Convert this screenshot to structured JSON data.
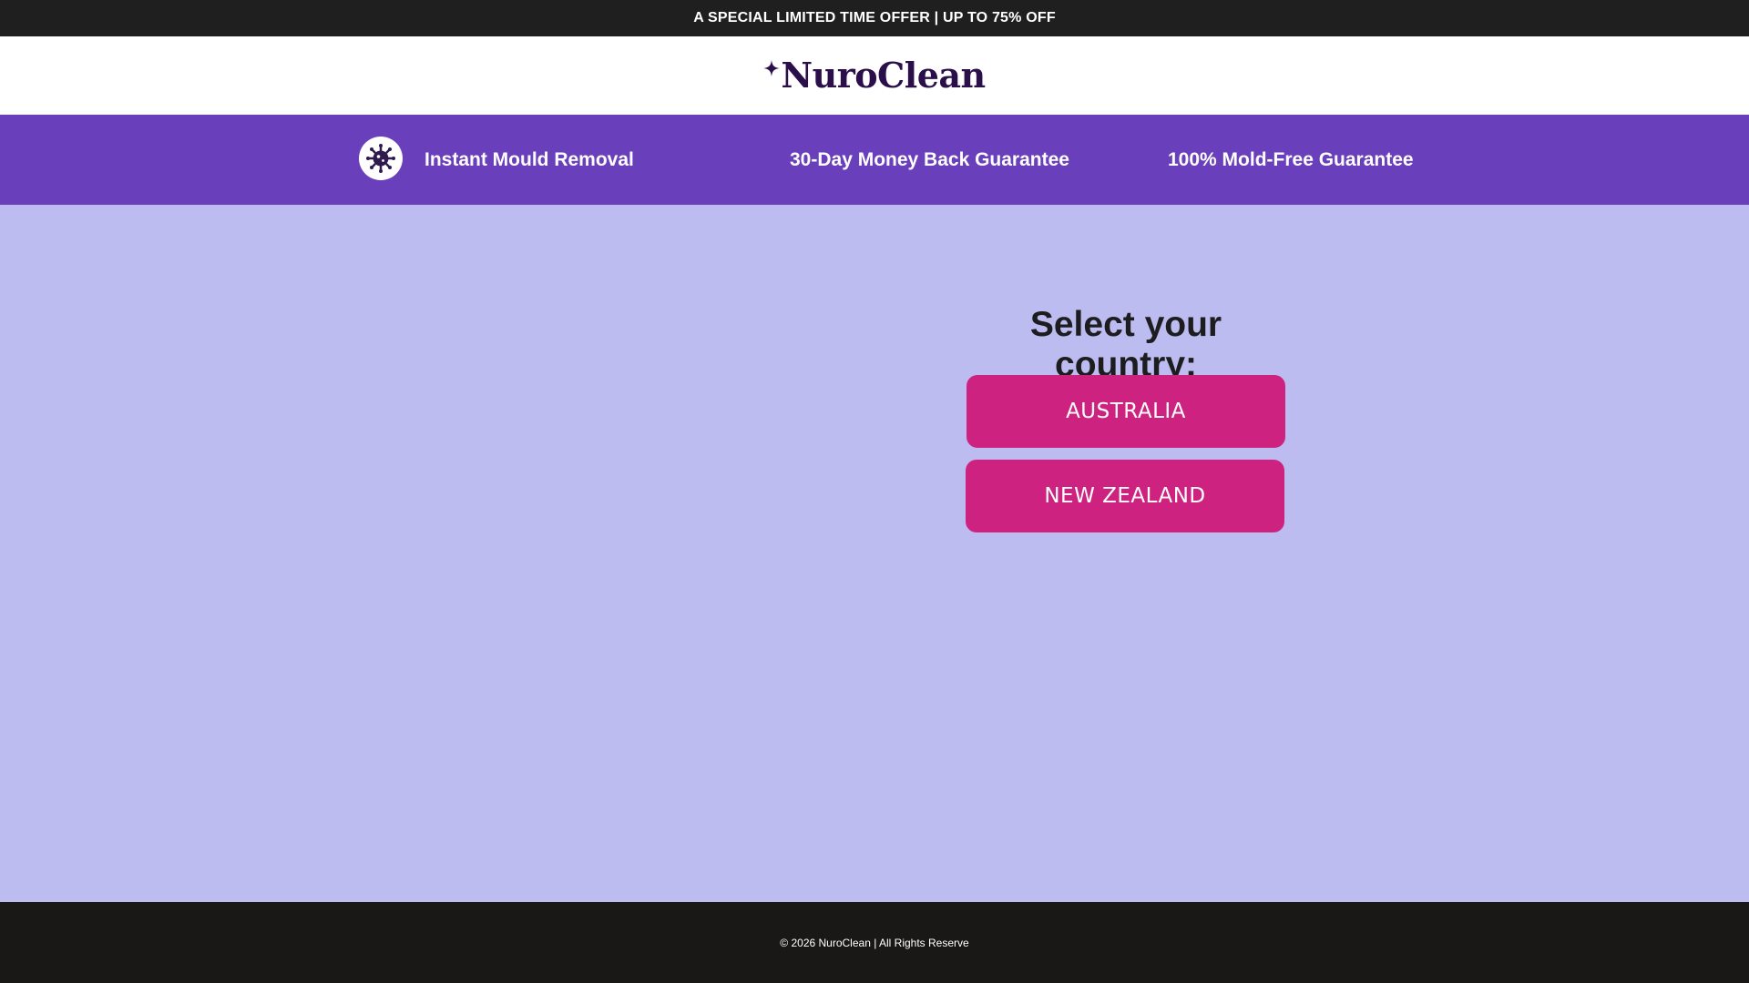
{
  "announcement": {
    "text": "A SPECIAL LIMITED TIME OFFER | UP TO 75% OFF"
  },
  "header": {
    "logo_text": "NuroClean",
    "logo_icon": "sparkle-icon"
  },
  "features": {
    "items": [
      {
        "label": "Instant Mould Removal",
        "icon": "mould-virus-icon"
      },
      {
        "label": "30-Day Money Back Guarantee"
      },
      {
        "label": "100% Mold-Free Guarantee"
      }
    ]
  },
  "country_select": {
    "title": "Select your country:",
    "options": [
      {
        "label": "AUSTRALIA"
      },
      {
        "label": "NEW ZEALAND"
      }
    ]
  },
  "footer": {
    "copyright": "© 2026 NuroClean | All Rights Reserve"
  },
  "colors": {
    "topbar_bg": "#201f1f",
    "feature_bar_bg": "#6a3fbb",
    "main_bg": "#bcbcf1",
    "button_bg": "#cd2280",
    "logo_color": "#2a0f4a",
    "footer_bg": "#1a1717"
  }
}
